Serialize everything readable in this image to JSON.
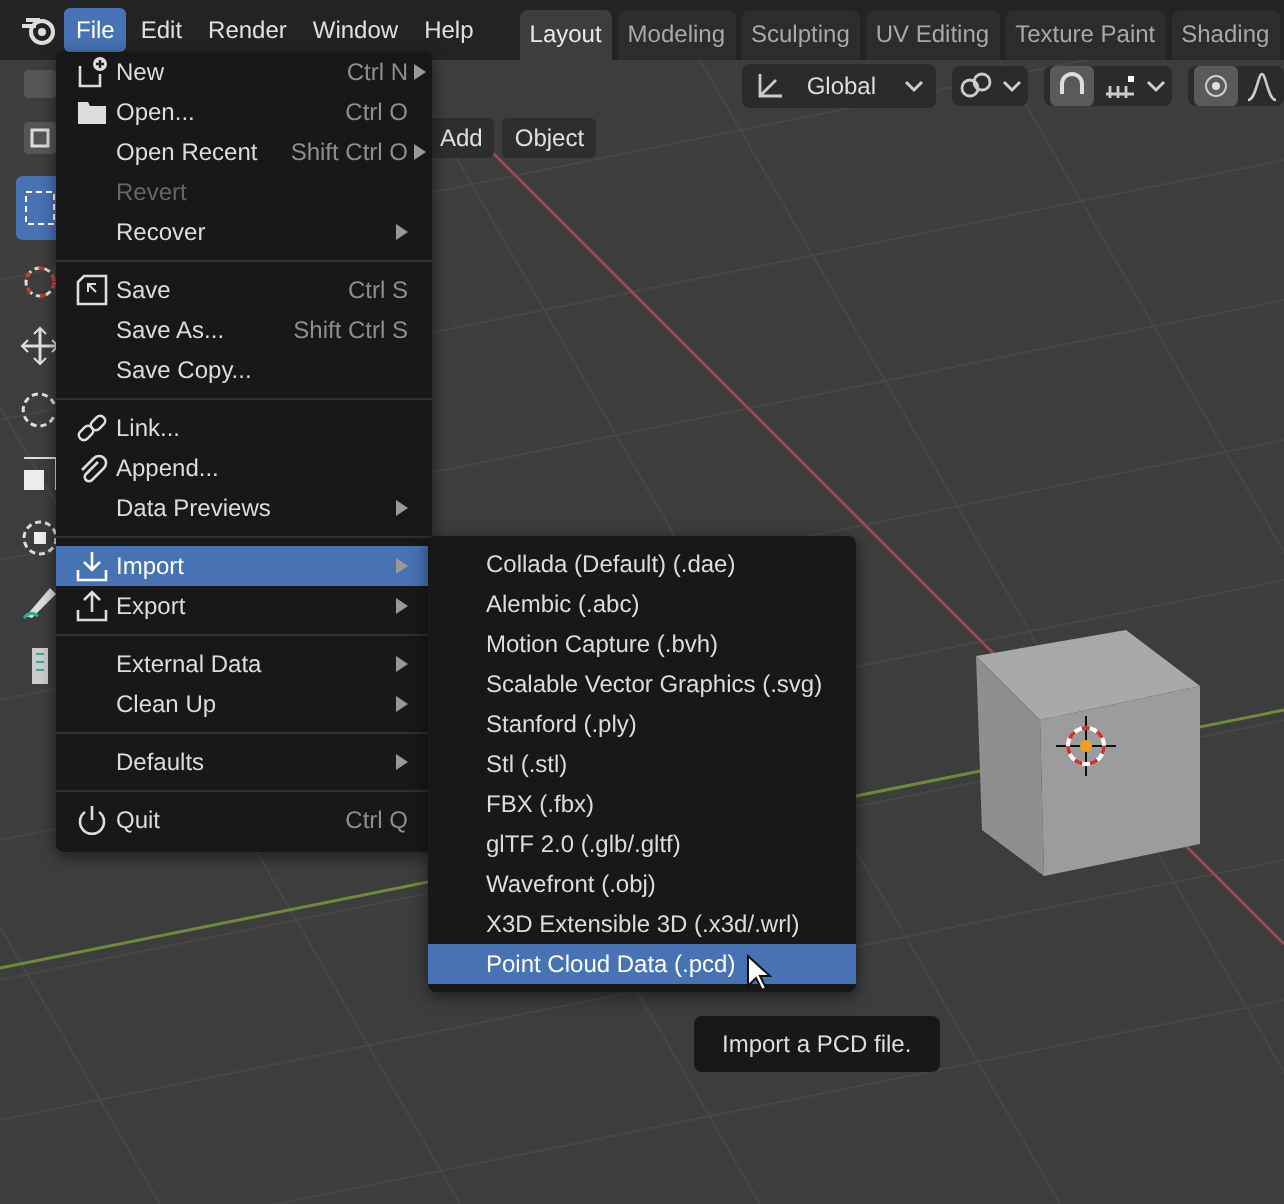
{
  "menubar": [
    {
      "label": "File",
      "selected": true
    },
    {
      "label": "Edit",
      "selected": false
    },
    {
      "label": "Render",
      "selected": false
    },
    {
      "label": "Window",
      "selected": false
    },
    {
      "label": "Help",
      "selected": false
    }
  ],
  "workspace_tabs": [
    {
      "label": "Layout",
      "selected": true
    },
    {
      "label": "Modeling",
      "selected": false
    },
    {
      "label": "Sculpting",
      "selected": false
    },
    {
      "label": "UV Editing",
      "selected": false
    },
    {
      "label": "Texture Paint",
      "selected": false
    },
    {
      "label": "Shading",
      "selected": false
    }
  ],
  "header": {
    "orientation": "Global"
  },
  "viewport_menu": [
    "Add",
    "Object"
  ],
  "file_menu": [
    [
      {
        "label": "New",
        "shortcut": "Ctrl N",
        "submenu": true,
        "disabled": false,
        "selected": false
      },
      {
        "label": "Open...",
        "shortcut": "Ctrl O",
        "submenu": false,
        "disabled": false,
        "selected": false
      },
      {
        "label": "Open Recent",
        "shortcut": "Shift Ctrl O",
        "submenu": true,
        "disabled": false,
        "selected": false
      },
      {
        "label": "Revert",
        "submenu": false,
        "disabled": true,
        "selected": false
      },
      {
        "label": "Recover",
        "submenu": true,
        "disabled": false,
        "selected": false
      }
    ],
    [
      {
        "label": "Save",
        "shortcut": "Ctrl S",
        "submenu": false,
        "disabled": false,
        "selected": false
      },
      {
        "label": "Save As...",
        "shortcut": "Shift Ctrl S",
        "submenu": false,
        "disabled": false,
        "selected": false
      },
      {
        "label": "Save Copy...",
        "submenu": false,
        "disabled": false,
        "selected": false
      }
    ],
    [
      {
        "label": "Link...",
        "submenu": false,
        "disabled": false,
        "selected": false
      },
      {
        "label": "Append...",
        "submenu": false,
        "disabled": false,
        "selected": false
      },
      {
        "label": "Data Previews",
        "submenu": true,
        "disabled": false,
        "selected": false
      }
    ],
    [
      {
        "label": "Import",
        "submenu": true,
        "disabled": false,
        "selected": true
      },
      {
        "label": "Export",
        "submenu": true,
        "disabled": false,
        "selected": false
      }
    ],
    [
      {
        "label": "External Data",
        "submenu": true,
        "disabled": false,
        "selected": false
      },
      {
        "label": "Clean Up",
        "submenu": true,
        "disabled": false,
        "selected": false
      }
    ],
    [
      {
        "label": "Defaults",
        "submenu": true,
        "disabled": false,
        "selected": false
      }
    ],
    [
      {
        "label": "Quit",
        "shortcut": "Ctrl Q",
        "submenu": false,
        "disabled": false,
        "selected": false
      }
    ]
  ],
  "import_menu": [
    {
      "label": "Collada (Default) (.dae)",
      "selected": false
    },
    {
      "label": "Alembic (.abc)",
      "selected": false
    },
    {
      "label": "Motion Capture (.bvh)",
      "selected": false
    },
    {
      "label": "Scalable Vector Graphics (.svg)",
      "selected": false
    },
    {
      "label": "Stanford (.ply)",
      "selected": false
    },
    {
      "label": "Stl (.stl)",
      "selected": false
    },
    {
      "label": "FBX (.fbx)",
      "selected": false
    },
    {
      "label": "glTF 2.0 (.glb/.gltf)",
      "selected": false
    },
    {
      "label": "Wavefront (.obj)",
      "selected": false
    },
    {
      "label": "X3D Extensible 3D (.x3d/.wrl)",
      "selected": false
    },
    {
      "label": "Point Cloud Data (.pcd)",
      "selected": true
    }
  ],
  "tooltip": "Import a PCD file."
}
